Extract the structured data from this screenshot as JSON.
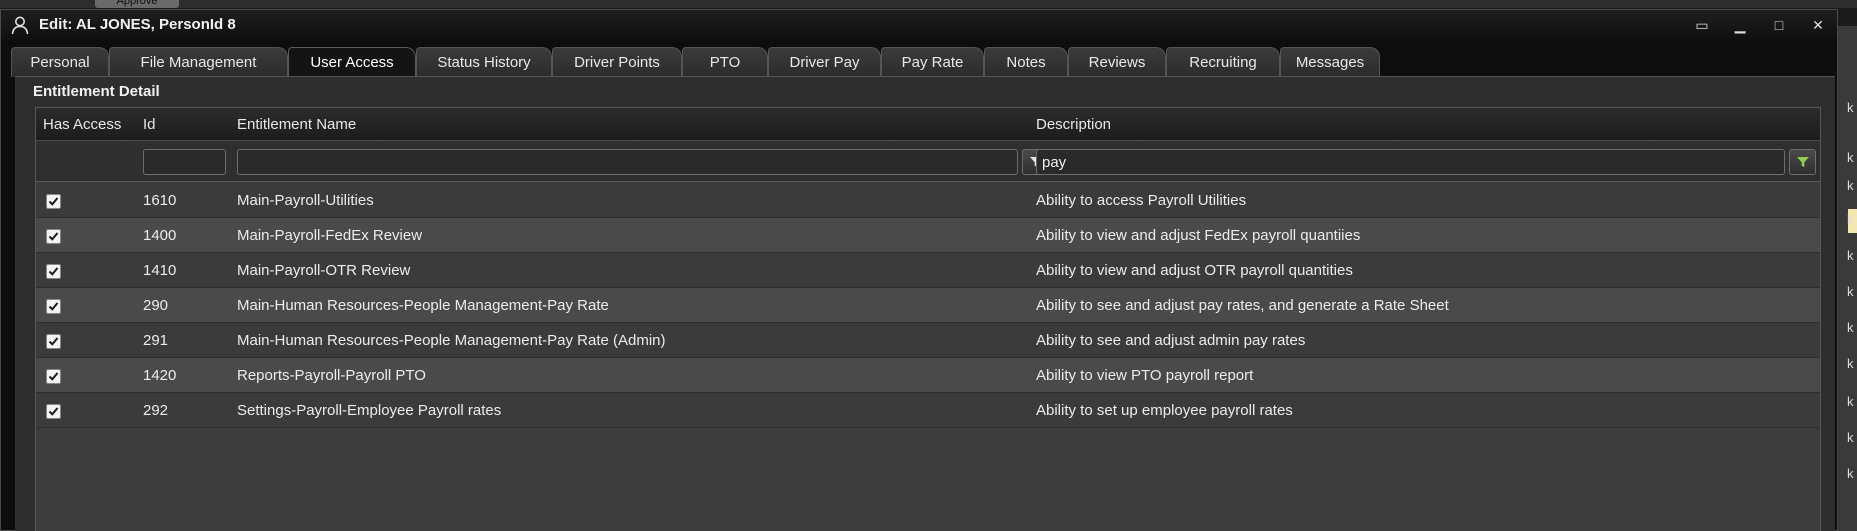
{
  "background": {
    "tab_label": "Approve",
    "right_letters": [
      "k",
      "k",
      "k",
      "k",
      "k",
      "k",
      "k",
      "k",
      "k",
      "k",
      "k"
    ]
  },
  "window": {
    "title": "Edit: AL JONES, PersonId 8",
    "controls": {
      "restore": "▭",
      "minimize": "▁",
      "maximize": "□",
      "close": "✕"
    }
  },
  "tabs": [
    {
      "label": "Personal",
      "active": false
    },
    {
      "label": "File Management",
      "active": false
    },
    {
      "label": "User Access",
      "active": true
    },
    {
      "label": "Status History",
      "active": false
    },
    {
      "label": "Driver Points",
      "active": false
    },
    {
      "label": "PTO",
      "active": false
    },
    {
      "label": "Driver Pay",
      "active": false
    },
    {
      "label": "Pay Rate",
      "active": false
    },
    {
      "label": "Notes",
      "active": false
    },
    {
      "label": "Reviews",
      "active": false
    },
    {
      "label": "Recruiting",
      "active": false
    },
    {
      "label": "Messages",
      "active": false
    }
  ],
  "section_title": "Entitlement Detail",
  "grid": {
    "columns": {
      "has_access": "Has Access",
      "id": "Id",
      "name": "Entitlement Name",
      "description": "Description"
    },
    "filters": {
      "id": "",
      "name": "",
      "description": "pay"
    },
    "icons": {
      "filter": "funnel-icon",
      "filter_active": "funnel-active-icon",
      "checkbox": "check-icon"
    },
    "colors": {
      "filter_active": "#8fd14f"
    },
    "rows": [
      {
        "has_access": true,
        "id": "1610",
        "name": "Main-Payroll-Utilities",
        "description": "Ability to access Payroll Utilities"
      },
      {
        "has_access": true,
        "id": "1400",
        "name": "Main-Payroll-FedEx Review",
        "description": "Ability to view and adjust FedEx payroll quantiies"
      },
      {
        "has_access": true,
        "id": "1410",
        "name": "Main-Payroll-OTR Review",
        "description": "Ability to view and adjust OTR payroll quantities"
      },
      {
        "has_access": true,
        "id": "290",
        "name": "Main-Human Resources-People Management-Pay Rate",
        "description": "Ability to see and adjust pay rates, and generate a Rate Sheet"
      },
      {
        "has_access": true,
        "id": "291",
        "name": "Main-Human Resources-People Management-Pay Rate (Admin)",
        "description": "Ability to see and adjust admin pay rates"
      },
      {
        "has_access": true,
        "id": "1420",
        "name": "Reports-Payroll-Payroll PTO",
        "description": "Ability to view PTO payroll report"
      },
      {
        "has_access": true,
        "id": "292",
        "name": "Settings-Payroll-Employee Payroll rates",
        "description": "Ability to set up employee payroll rates"
      }
    ]
  }
}
